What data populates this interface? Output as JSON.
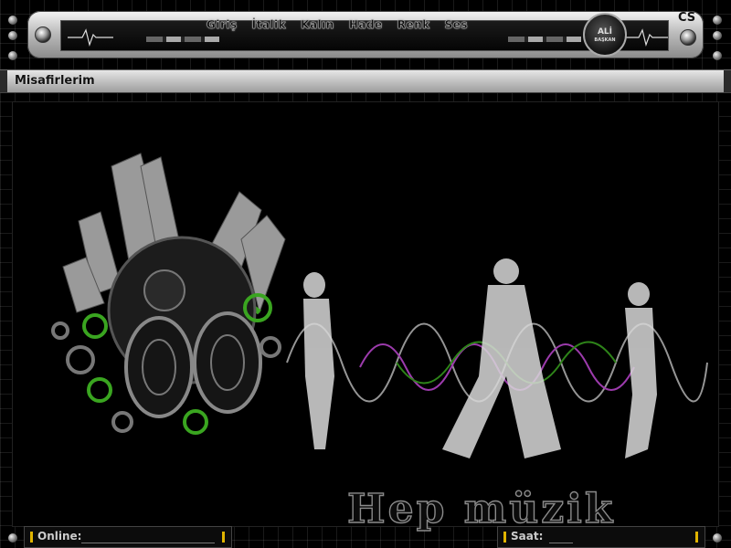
{
  "nav": {
    "items": [
      "Giriş",
      "İtalik",
      "Kalın",
      "Hade",
      "Renk",
      "Ses"
    ]
  },
  "logo": {
    "title": "ALİ",
    "subtitle": "BAŞKAN"
  },
  "corner_mark": "CS",
  "section": {
    "title": "Misafirlerim"
  },
  "hero": {
    "title": "Hep müzik"
  },
  "footer": {
    "online_label": "Online:",
    "saat_label": "Saat:"
  },
  "colors": {
    "accent_green": "#3aa520",
    "marker_yellow": "#e0b400"
  }
}
